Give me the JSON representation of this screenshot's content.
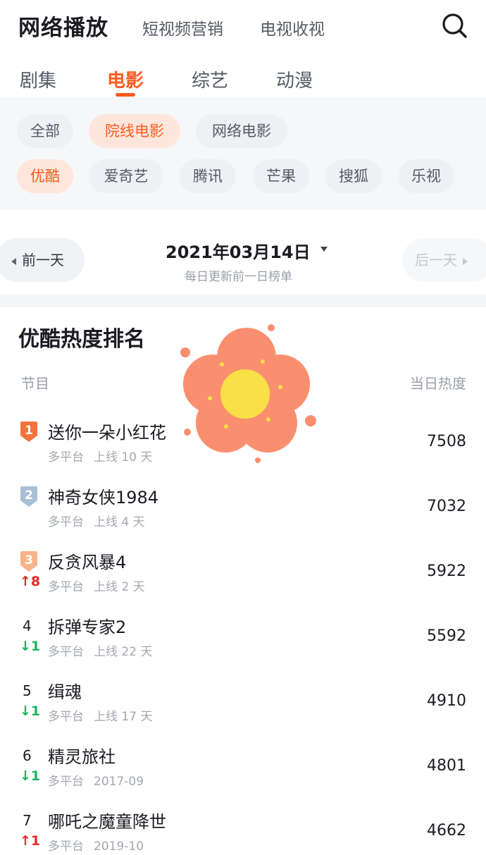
{
  "header": {
    "app_title": "网络播放",
    "nav": [
      "短视频营销",
      "电视收视"
    ]
  },
  "category_tabs": [
    {
      "label": "剧集",
      "active": false
    },
    {
      "label": "电影",
      "active": true
    },
    {
      "label": "综艺",
      "active": false
    },
    {
      "label": "动漫",
      "active": false
    }
  ],
  "filters": {
    "type_chips": [
      {
        "label": "全部",
        "active": false
      },
      {
        "label": "院线电影",
        "active": true
      },
      {
        "label": "网络电影",
        "active": false
      }
    ],
    "platform_chips": [
      {
        "label": "优酷",
        "active": true
      },
      {
        "label": "爱奇艺",
        "active": false
      },
      {
        "label": "腾讯",
        "active": false
      },
      {
        "label": "芒果",
        "active": false
      },
      {
        "label": "搜狐",
        "active": false
      },
      {
        "label": "乐视",
        "active": false
      }
    ]
  },
  "date_nav": {
    "prev_label": "前一天",
    "next_label": "后一天",
    "date": "2021年03月14日",
    "subtitle": "每日更新前一日榜单"
  },
  "ranking": {
    "title": "优酷热度排名",
    "col_program": "节目",
    "col_heat": "当日热度",
    "rows": [
      {
        "rank": "1",
        "badge_color": "#f5733a",
        "trend": "",
        "trend_dir": "",
        "title": "送你一朵小红花",
        "platform": "多平台",
        "release": "上线 10 天",
        "heat": "7508"
      },
      {
        "rank": "2",
        "badge_color": "#a9bfd6",
        "trend": "",
        "trend_dir": "",
        "title": "神奇女侠1984",
        "platform": "多平台",
        "release": "上线 4 天",
        "heat": "7032"
      },
      {
        "rank": "3",
        "badge_color": "#f8b489",
        "trend": "↑8",
        "trend_dir": "up",
        "title": "反贪风暴4",
        "platform": "多平台",
        "release": "上线 2 天",
        "heat": "5922"
      },
      {
        "rank": "4",
        "badge_color": "",
        "trend": "↓1",
        "trend_dir": "down",
        "title": "拆弹专家2",
        "platform": "多平台",
        "release": "上线 22 天",
        "heat": "5592"
      },
      {
        "rank": "5",
        "badge_color": "",
        "trend": "↓1",
        "trend_dir": "down",
        "title": "缉魂",
        "platform": "多平台",
        "release": "上线 17 天",
        "heat": "4910"
      },
      {
        "rank": "6",
        "badge_color": "",
        "trend": "↓1",
        "trend_dir": "down",
        "title": "精灵旅社",
        "platform": "多平台",
        "release": "2017-09",
        "heat": "4801"
      },
      {
        "rank": "7",
        "badge_color": "",
        "trend": "↑1",
        "trend_dir": "up",
        "title": "哪吒之魔童降世",
        "platform": "多平台",
        "release": "2019-10",
        "heat": "4662"
      }
    ]
  },
  "colors": {
    "accent": "#ff5a1f",
    "up": "#e52a2a",
    "down": "#19b55a"
  }
}
